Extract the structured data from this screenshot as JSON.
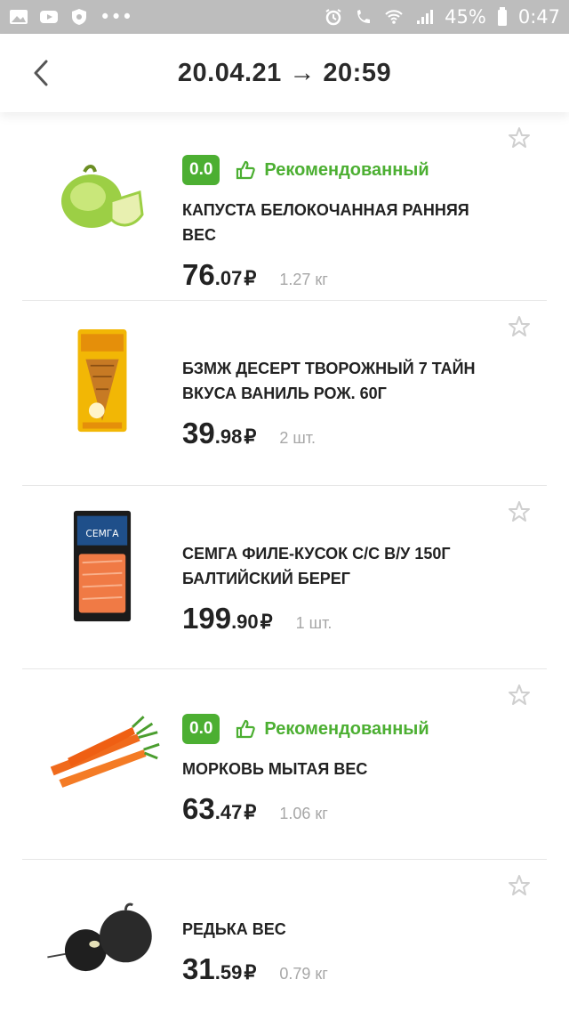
{
  "status_bar": {
    "battery": "45%",
    "time": "0:47",
    "dots": "•••"
  },
  "header": {
    "title": "20.04.21 → 20:59"
  },
  "items": [
    {
      "score": "0.0",
      "recommended": "Рекомендованный",
      "name": "КАПУСТА БЕЛОКОЧАННАЯ РАННЯЯ ВЕС",
      "price_int": "76",
      "price_dec": ".07",
      "currency": "₽",
      "qty": "1.27 кг",
      "image": "cabbage"
    },
    {
      "name": "БЗМЖ ДЕСЕРТ ТВОРОЖНЫЙ 7 ТАЙН ВКУСА ВАНИЛЬ РОЖ. 60Г",
      "price_int": "39",
      "price_dec": ".98",
      "currency": "₽",
      "qty": "2 шт.",
      "image": "ice-cream-cone"
    },
    {
      "name": "СЕМГА ФИЛЕ-КУСОК С/С В/У 150Г БАЛТИЙСКИЙ БЕРЕГ",
      "price_int": "199",
      "price_dec": ".90",
      "currency": "₽",
      "qty": "1 шт.",
      "image": "salmon-pack",
      "pack_label": "СЕМГА"
    },
    {
      "score": "0.0",
      "recommended": "Рекомендованный",
      "name": "МОРКОВЬ МЫТАЯ ВЕС",
      "price_int": "63",
      "price_dec": ".47",
      "currency": "₽",
      "qty": "1.06 кг",
      "image": "carrots"
    },
    {
      "name": "РЕДЬКА ВЕС",
      "price_int": "31",
      "price_dec": ".59",
      "currency": "₽",
      "qty": "0.79 кг",
      "image": "black-radish"
    }
  ],
  "colors": {
    "accent_green": "#4caf32",
    "statusbar": "#bdbdbd"
  }
}
